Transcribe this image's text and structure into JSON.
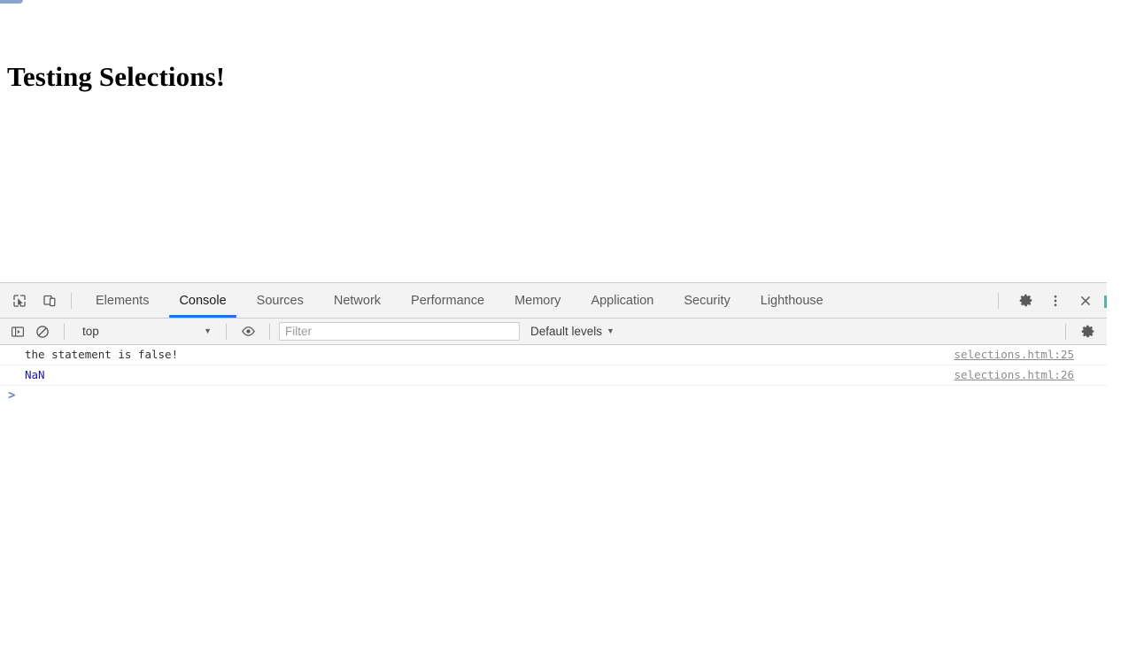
{
  "page": {
    "heading": "Testing Selections!"
  },
  "devtools": {
    "toolbar": {
      "inspect_icon": "inspect-element-icon",
      "device_icon": "device-toolbar-icon",
      "settings_icon": "gear-icon",
      "more_icon": "more-options-icon",
      "close_icon": "close-icon",
      "tabs": [
        {
          "label": "Elements",
          "active": false
        },
        {
          "label": "Console",
          "active": true
        },
        {
          "label": "Sources",
          "active": false
        },
        {
          "label": "Network",
          "active": false
        },
        {
          "label": "Performance",
          "active": false
        },
        {
          "label": "Memory",
          "active": false
        },
        {
          "label": "Application",
          "active": false
        },
        {
          "label": "Security",
          "active": false
        },
        {
          "label": "Lighthouse",
          "active": false
        }
      ]
    },
    "console_toolbar": {
      "sidebar_icon": "console-sidebar-icon",
      "clear_icon": "clear-console-icon",
      "context_value": "top",
      "context_caret": "▼",
      "eye_icon": "eye-icon",
      "filter_placeholder": "Filter",
      "filter_value": "",
      "levels_label": "Default levels",
      "levels_caret": "▼",
      "settings_icon": "gear-icon"
    },
    "console": {
      "messages": [
        {
          "text": "the statement is false!",
          "type": "log",
          "source": "selections.html:25"
        },
        {
          "text": "NaN",
          "type": "number",
          "source": "selections.html:26"
        }
      ],
      "prompt_caret": ">",
      "prompt_value": ""
    },
    "colors": {
      "accent": "#1a73e8",
      "number": "#1a1aa6",
      "prompt": "#6a84c7",
      "toolbar_bg": "#f3f3f3",
      "text": "#303030",
      "source_link": "#8c8c8c"
    }
  }
}
